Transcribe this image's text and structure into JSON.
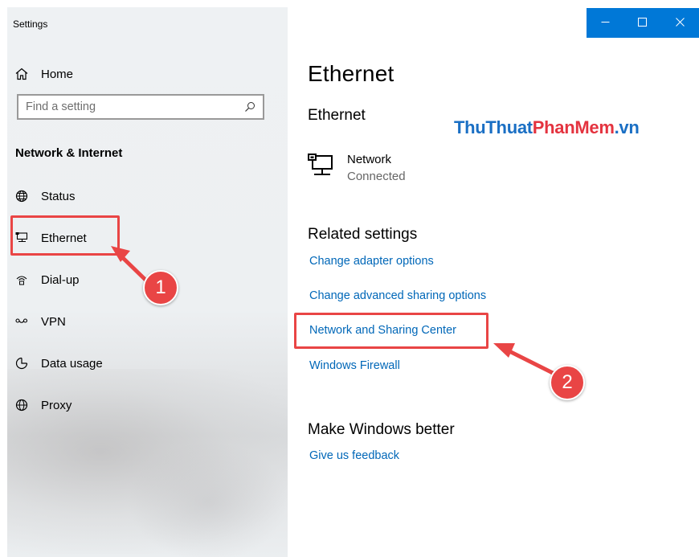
{
  "window": {
    "title": "Settings"
  },
  "sidebar": {
    "home_label": "Home",
    "search_placeholder": "Find a setting",
    "section_header": "Network & Internet",
    "items": [
      {
        "label": "Status",
        "icon": "globe-icon"
      },
      {
        "label": "Ethernet",
        "icon": "ethernet-icon"
      },
      {
        "label": "Dial-up",
        "icon": "dialup-icon"
      },
      {
        "label": "VPN",
        "icon": "vpn-icon"
      },
      {
        "label": "Data usage",
        "icon": "data-usage-icon"
      },
      {
        "label": "Proxy",
        "icon": "proxy-globe-icon"
      }
    ]
  },
  "main": {
    "title": "Ethernet",
    "subtitle": "Ethernet",
    "network": {
      "name": "Network",
      "status": "Connected"
    },
    "related_heading": "Related settings",
    "related_links": [
      "Change adapter options",
      "Change advanced sharing options",
      "Network and Sharing Center",
      "Windows Firewall"
    ],
    "better_heading": "Make Windows better",
    "feedback_link": "Give us feedback"
  },
  "watermark": {
    "part1": "ThuThuat",
    "part2": "PhanMem",
    "part3": ".vn"
  },
  "annotations": {
    "callout1": "1",
    "callout2": "2",
    "color": "#e94545"
  },
  "colors": {
    "accent": "#0078d7",
    "link": "#0067b8"
  }
}
